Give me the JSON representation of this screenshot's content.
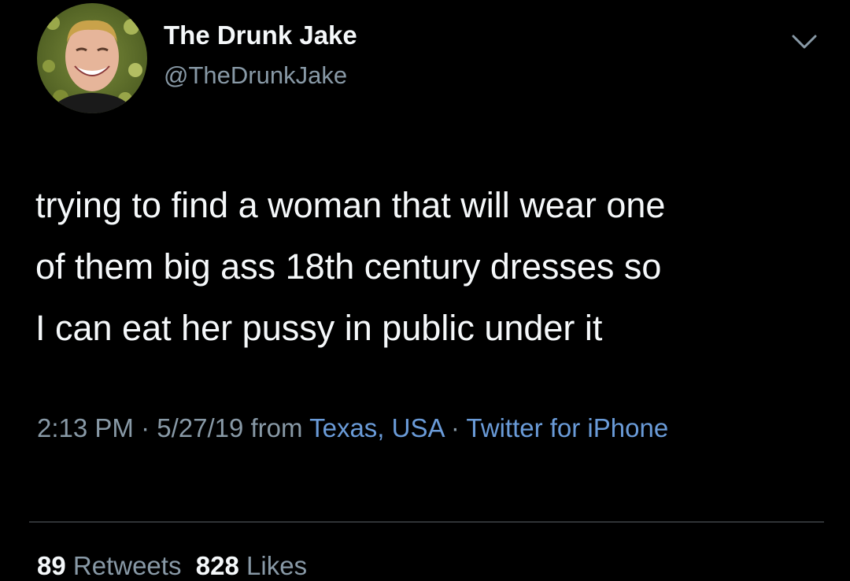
{
  "author": {
    "display_name": "The Drunk Jake",
    "handle": "@TheDrunkJake",
    "avatar_icon": "avatar-photo"
  },
  "menu": {
    "icon": "chevron-down-icon"
  },
  "tweet": {
    "text": "trying to find a woman that will wear one\nof them big ass 18th century dresses so\nI can eat her pussy in public under it"
  },
  "meta": {
    "time": "2:13 PM",
    "separator1": " · ",
    "date": "5/27/19",
    "from_label": " from ",
    "location": "Texas, USA",
    "separator2": " · ",
    "source": "Twitter for iPhone"
  },
  "stats": {
    "retweets_count": "89",
    "retweets_label": "Retweets",
    "likes_count": "828",
    "likes_label": "Likes"
  },
  "colors": {
    "background": "#000000",
    "primary_text": "#f5f8fa",
    "secondary_text": "#8899a6",
    "link": "#6a9bd8",
    "divider": "#2f3336"
  }
}
